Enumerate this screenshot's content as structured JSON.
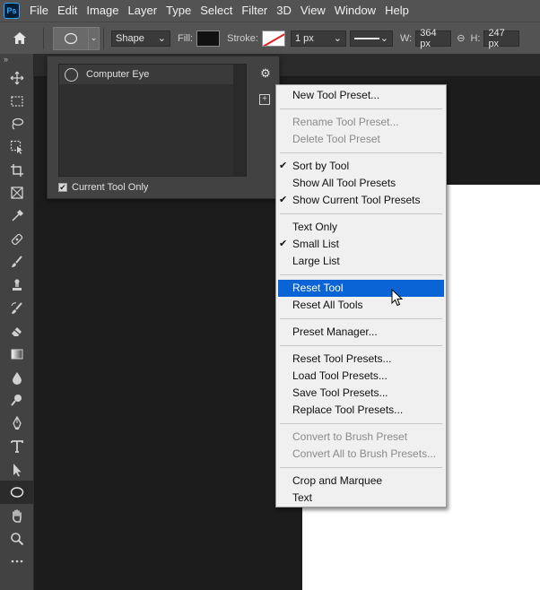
{
  "menubar": {
    "logo": "Ps",
    "items": [
      "File",
      "Edit",
      "Image",
      "Layer",
      "Type",
      "Select",
      "Filter",
      "3D",
      "View",
      "Window",
      "Help"
    ]
  },
  "options": {
    "mode": "Shape",
    "fill_label": "Fill:",
    "stroke_label": "Stroke:",
    "stroke_width": "1 px",
    "w_label": "W:",
    "w_value": "364 px",
    "h_label": "H:",
    "h_value": "247 px"
  },
  "preset_panel": {
    "preset_name": "Computer Eye",
    "current_tool_only": "Current Tool Only"
  },
  "context_menu": {
    "groups": [
      [
        {
          "label": "New Tool Preset...",
          "enabled": true,
          "checked": false
        }
      ],
      [
        {
          "label": "Rename Tool Preset...",
          "enabled": false,
          "checked": false
        },
        {
          "label": "Delete Tool Preset",
          "enabled": false,
          "checked": false
        }
      ],
      [
        {
          "label": "Sort by Tool",
          "enabled": true,
          "checked": true
        },
        {
          "label": "Show All Tool Presets",
          "enabled": true,
          "checked": false
        },
        {
          "label": "Show Current Tool Presets",
          "enabled": true,
          "checked": true
        }
      ],
      [
        {
          "label": "Text Only",
          "enabled": true,
          "checked": false
        },
        {
          "label": "Small List",
          "enabled": true,
          "checked": true
        },
        {
          "label": "Large List",
          "enabled": true,
          "checked": false
        }
      ],
      [
        {
          "label": "Reset Tool",
          "enabled": true,
          "checked": false,
          "highlighted": true
        },
        {
          "label": "Reset All Tools",
          "enabled": true,
          "checked": false
        }
      ],
      [
        {
          "label": "Preset Manager...",
          "enabled": true,
          "checked": false
        }
      ],
      [
        {
          "label": "Reset Tool Presets...",
          "enabled": true,
          "checked": false
        },
        {
          "label": "Load Tool Presets...",
          "enabled": true,
          "checked": false
        },
        {
          "label": "Save Tool Presets...",
          "enabled": true,
          "checked": false
        },
        {
          "label": "Replace Tool Presets...",
          "enabled": true,
          "checked": false
        }
      ],
      [
        {
          "label": "Convert to Brush Preset",
          "enabled": false,
          "checked": false
        },
        {
          "label": "Convert All to Brush Presets...",
          "enabled": false,
          "checked": false
        }
      ],
      [
        {
          "label": "Crop and Marquee",
          "enabled": true,
          "checked": false
        },
        {
          "label": "Text",
          "enabled": true,
          "checked": false
        }
      ]
    ]
  },
  "toolbar": {
    "tools": [
      "move-icon",
      "marquee-icon",
      "lasso-icon",
      "object-select-icon",
      "crop-icon",
      "frame-icon",
      "eyedropper-icon",
      "healing-icon",
      "brush-icon",
      "stamp-icon",
      "history-brush-icon",
      "eraser-icon",
      "gradient-icon",
      "blur-icon",
      "dodge-icon",
      "pen-icon",
      "type-icon",
      "path-select-icon",
      "ellipse-icon",
      "hand-icon",
      "zoom-icon",
      "more-icon"
    ],
    "active_tool": "ellipse-icon"
  }
}
